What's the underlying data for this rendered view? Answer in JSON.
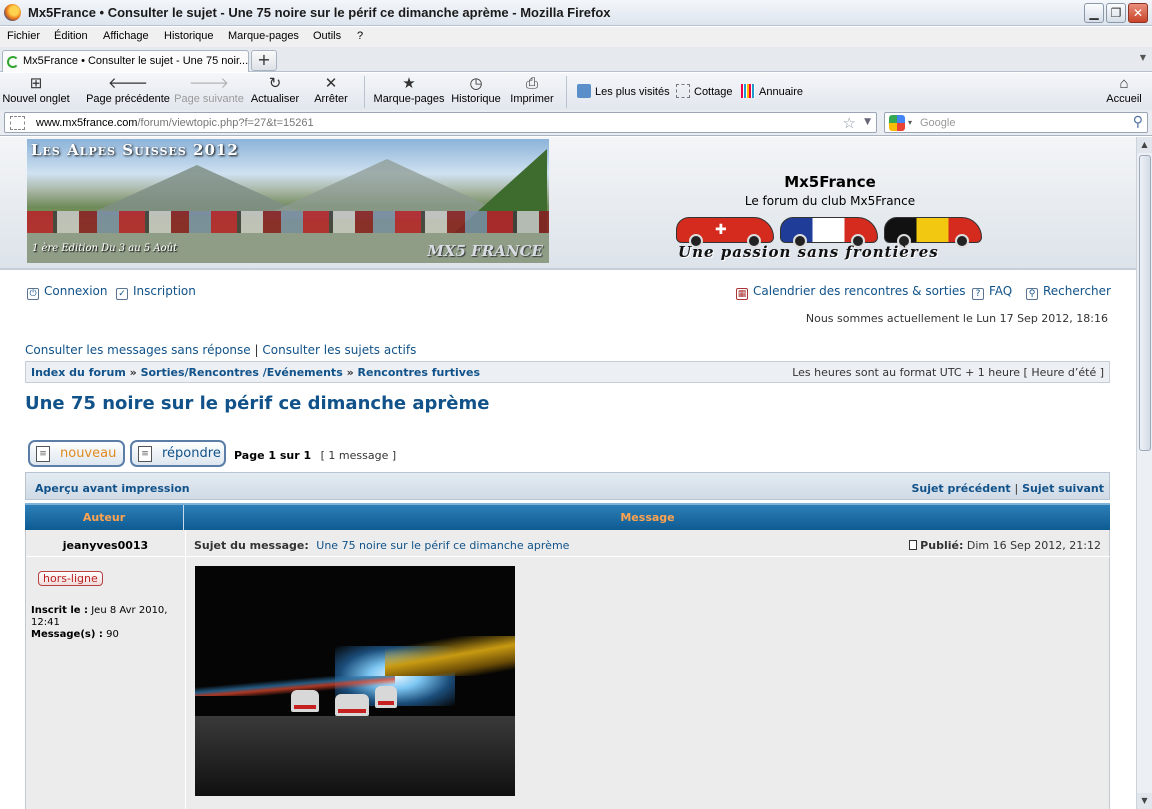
{
  "browser": {
    "window_title": "Mx5France • Consulter le sujet - Une 75 noire sur le périf ce dimanche aprème - Mozilla Firefox",
    "menu": [
      "Fichier",
      "Édition",
      "Affichage",
      "Historique",
      "Marque-pages",
      "Outils",
      "?"
    ],
    "tab_title": "Mx5France • Consulter le sujet - Une 75 noir...",
    "newtab_label": "+",
    "toolbar": {
      "new_tab": "Nouvel onglet",
      "back": "Page précédente",
      "forward": "Page suivante",
      "reload": "Actualiser",
      "stop": "Arrêter",
      "bookmarks": "Marque-pages",
      "history": "Historique",
      "print": "Imprimer",
      "home": "Accueil"
    },
    "bookmarks_bar": [
      "Les plus visités",
      "Cottage",
      "Annuaire"
    ],
    "url_host": "www.mx5france.com",
    "url_path": "/forum/viewtopic.php?f=27&t=15261",
    "search_placeholder": "Google"
  },
  "header": {
    "banner_title": "Les Alpes Suisses 2012",
    "banner_subtitle": "1 ère Edition Du 3 au 5 Août",
    "banner_logo": "MX5 FRANCE",
    "site_name": "Mx5France",
    "site_description": "Le forum du club Mx5France",
    "slogan": "Une passion sans frontières",
    "colors": {
      "swiss": "#d52b1e",
      "france_blue": "#1f3c99",
      "belgium_yellow": "#f2c811"
    }
  },
  "nav": {
    "login": "Connexion",
    "register": "Inscription",
    "calendar": "Calendrier des rencontres & sorties",
    "faq": "FAQ",
    "search": "Rechercher",
    "date_text": "Nous sommes actuellement le Lun 17 Sep 2012, 18:16",
    "unanswered": "Consulter les messages sans réponse",
    "active": "Consulter les sujets actifs",
    "quick_sep": "|"
  },
  "breadcrumb": {
    "items": [
      "Index du forum",
      "Sorties/Rencontres /Evénements",
      "Rencontres furtives"
    ],
    "sep": "»",
    "timezone": "Les heures sont au format UTC + 1 heure [ Heure d’été ]"
  },
  "topic": {
    "title": "Une 75 noire sur le périf ce dimanche aprème",
    "btn_new": "nouveau",
    "btn_reply": "répondre",
    "page_info": "Page 1 sur 1",
    "message_count": "[ 1 message ]",
    "print_view": "Aperçu avant impression",
    "prev_topic": "Sujet précédent",
    "next_topic": "Sujet suivant",
    "pipe": "|"
  },
  "table": {
    "col_author": "Auteur",
    "col_message": "Message"
  },
  "post": {
    "author": "jeanyves0013",
    "subject_label": "Sujet du message:",
    "subject": "Une 75 noire sur le périf ce dimanche aprème",
    "posted_label": "Publié:",
    "posted_date": "Dim 16 Sep 2012, 21:12",
    "status": "hors-ligne",
    "registered_label": "Inscrit le :",
    "registered_value": "Jeu 8 Avr 2010, 12:41",
    "messages_label": "Message(s) :",
    "messages_value": "90"
  }
}
